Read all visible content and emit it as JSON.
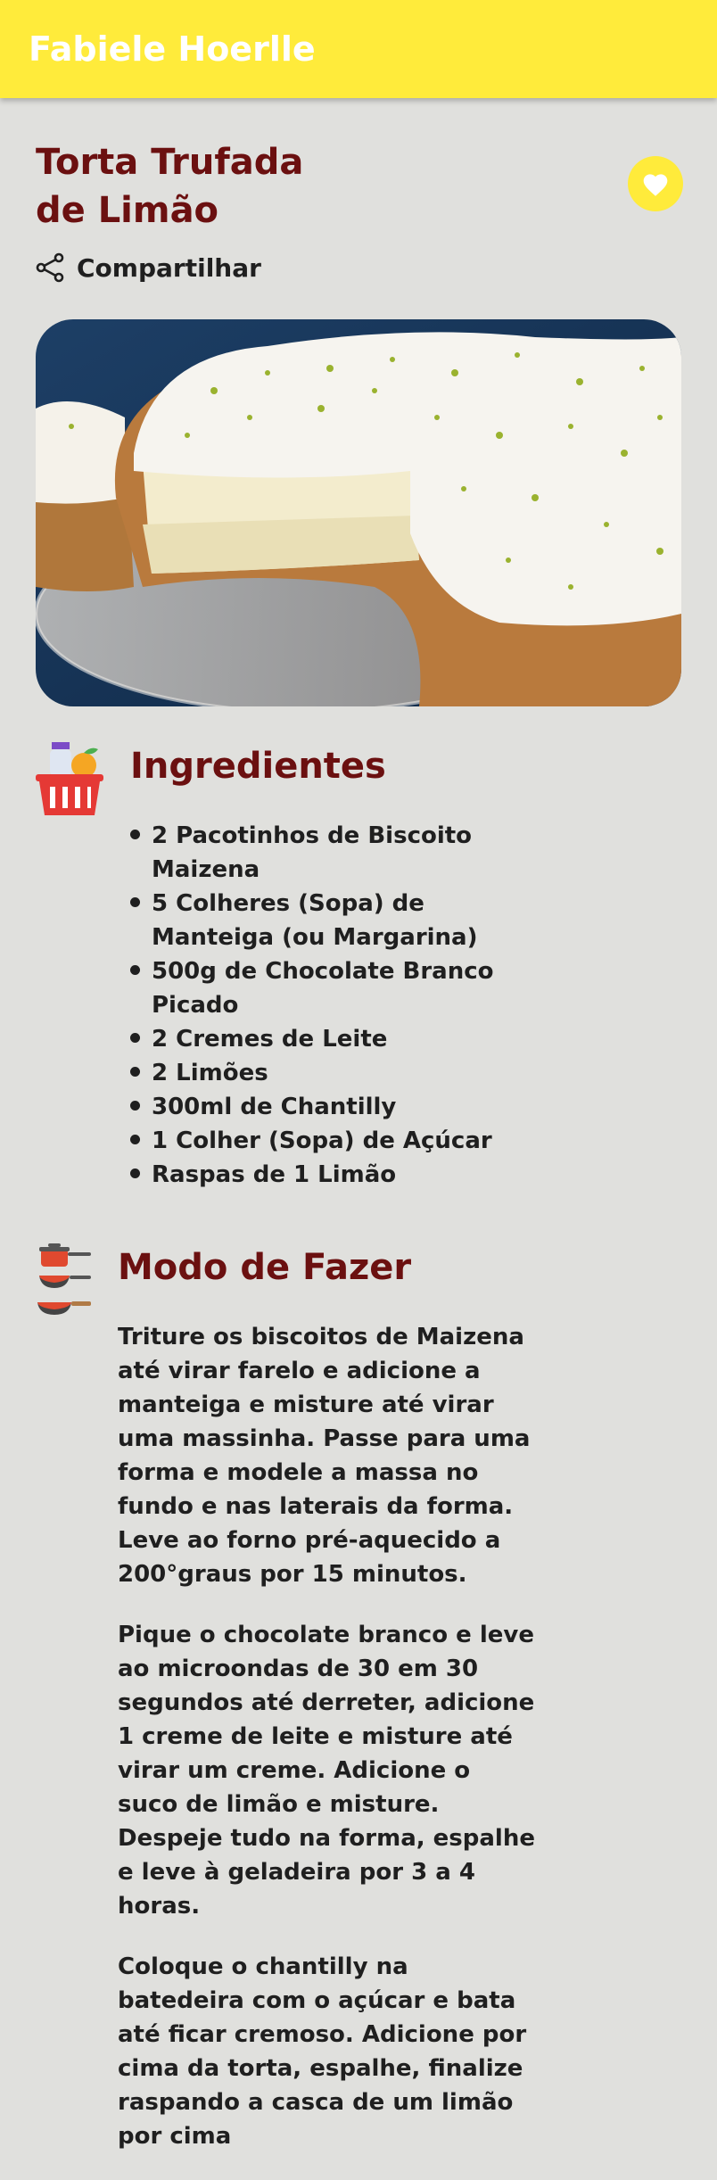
{
  "app_bar": {
    "title": "Fabiele Hoerlle",
    "color": "#ffeb3b"
  },
  "recipe": {
    "title": "Torta Trufada de Limão",
    "share_label": "Compartilhar",
    "favorite_icon": "heart-icon",
    "share_icon": "share-icon",
    "image_alt": "torta de limão com chantilly"
  },
  "ingredients_section": {
    "title": "Ingredientes",
    "icon": "grocery-basket-icon",
    "items": [
      "2 Pacotinhos de Biscoito Maizena",
      "5 Colheres (Sopa) de Manteiga (ou Margarina)",
      "500g de Chocolate Branco Picado",
      "2 Cremes de Leite",
      "2 Limões",
      "300ml de Chantilly",
      "1 Colher (Sopa) de Açúcar",
      "Raspas de 1 Limão"
    ]
  },
  "method_section": {
    "title": "Modo de Fazer",
    "icon": "cooking-pans-icon",
    "steps": [
      "Triture os biscoitos de Maizena até virar farelo e adicione a manteiga e misture até virar uma massinha. Passe para uma forma e modele a massa no fundo e nas laterais da forma. Leve ao forno pré-aquecido a 200°graus por 15 minutos.",
      "Pique o chocolate branco e leve ao microondas de 30 em 30 segundos até derreter, adicione 1 creme de leite e misture até virar um creme. Adicione o suco de limão e misture. Despeje tudo na forma, espalhe e leve à geladeira por 3 a 4 horas.",
      "Coloque o chantilly na batedeira com o açúcar e bata até ficar cremoso. Adicione por cima da torta, espalhe, finalize raspando a casca de um limão por cima"
    ]
  },
  "colors": {
    "title": "#6b1010",
    "background": "#e0e0dd",
    "accent": "#ffeb3b"
  }
}
